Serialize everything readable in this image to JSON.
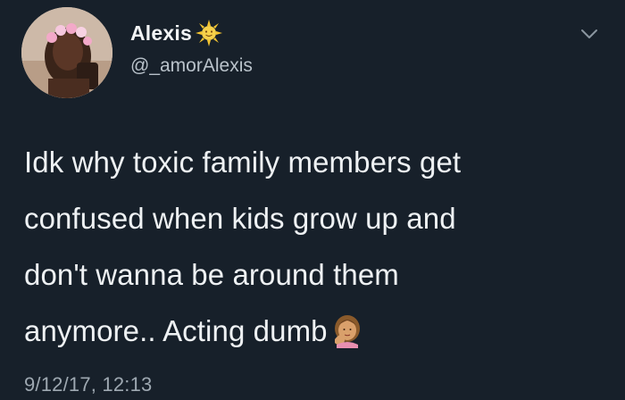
{
  "author": {
    "display_name": "Alexis",
    "handle": "@_amorAlexis",
    "name_emoji": "sun-with-face-icon"
  },
  "tweet": {
    "line1": "Idk why toxic family members get",
    "line2": "confused when kids grow up and",
    "line3": "don't wanna be around them",
    "line4": "anymore.. Acting dumb",
    "trailing_emoji": "facepalm-icon"
  },
  "timestamp": "9/12/17, 12:13",
  "colors": {
    "background": "#17202a",
    "text_primary": "#eef1f3",
    "text_secondary": "#9ea8b1"
  }
}
